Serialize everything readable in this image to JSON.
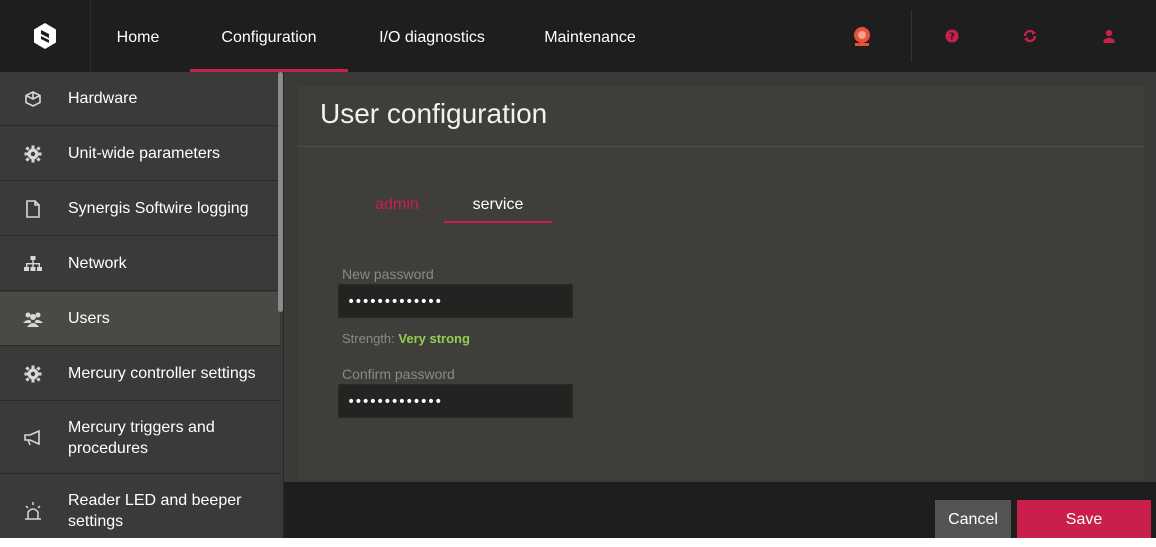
{
  "nav": {
    "tabs": [
      {
        "label": "Home"
      },
      {
        "label": "Configuration"
      },
      {
        "label": "I/O diagnostics"
      },
      {
        "label": "Maintenance"
      }
    ],
    "active_tab": "Configuration"
  },
  "top_icons": [
    "alarm-bell-icon",
    "help-icon",
    "refresh-icon",
    "user-icon"
  ],
  "sidebar": {
    "items": [
      {
        "label": "Hardware",
        "icon": "cube-icon"
      },
      {
        "label": "Unit-wide parameters",
        "icon": "gear-icon"
      },
      {
        "label": "Synergis Softwire logging",
        "icon": "document-icon"
      },
      {
        "label": "Network",
        "icon": "network-icon"
      },
      {
        "label": "Users",
        "icon": "users-icon"
      },
      {
        "label": "Mercury controller settings",
        "icon": "gear-icon"
      },
      {
        "label": "Mercury triggers and procedures",
        "icon": "megaphone-icon"
      },
      {
        "label": "Reader LED and beeper settings",
        "icon": "alarm-light-icon"
      }
    ],
    "active_item": "Users"
  },
  "main": {
    "title": "User configuration",
    "user_tabs": [
      {
        "label": "admin"
      },
      {
        "label": "service"
      }
    ],
    "active_user_tab": "service",
    "new_password": {
      "label": "New password",
      "value": "•••••••••••••"
    },
    "strength": {
      "prefix": "Strength:",
      "value": "Very strong"
    },
    "confirm_password": {
      "label": "Confirm password",
      "value": "•••••••••••••"
    }
  },
  "footer": {
    "cancel_label": "Cancel",
    "save_label": "Save"
  },
  "colors": {
    "accent": "#c8204a",
    "strength_ok": "#8fd14f",
    "topbar_bg": "#1e1e1e",
    "sidebar_bg": "#3b3a38"
  }
}
